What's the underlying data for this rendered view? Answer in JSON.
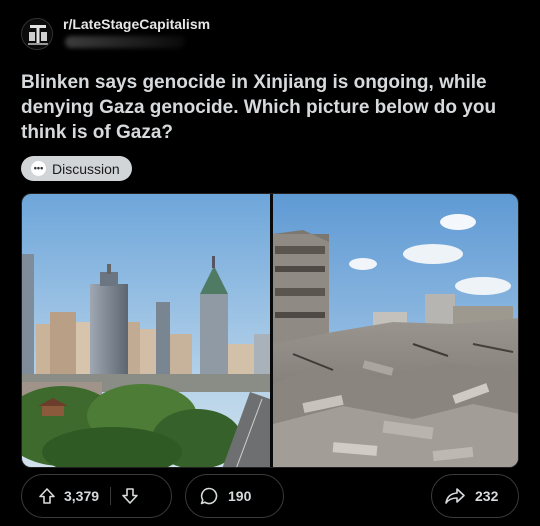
{
  "post": {
    "subreddit": "r/LateStageCapitalism",
    "title": "Blinken says genocide in Xinjiang is ongoing, while denying Gaza genocide. Which picture below do you think is of Gaza?",
    "flair": {
      "label": "Discussion",
      "icon": "chat-bubble-icon"
    },
    "images": [
      {
        "icon": "city-skyline-image"
      },
      {
        "icon": "rubble-ruins-image"
      }
    ]
  },
  "actions": {
    "upvotes": "3,379",
    "comments": "190",
    "shares": "232"
  },
  "colors": {
    "background": "#000000",
    "flair_bg": "#d2d5d8",
    "text": "#d7dadc",
    "border": "#3a3a3c"
  }
}
